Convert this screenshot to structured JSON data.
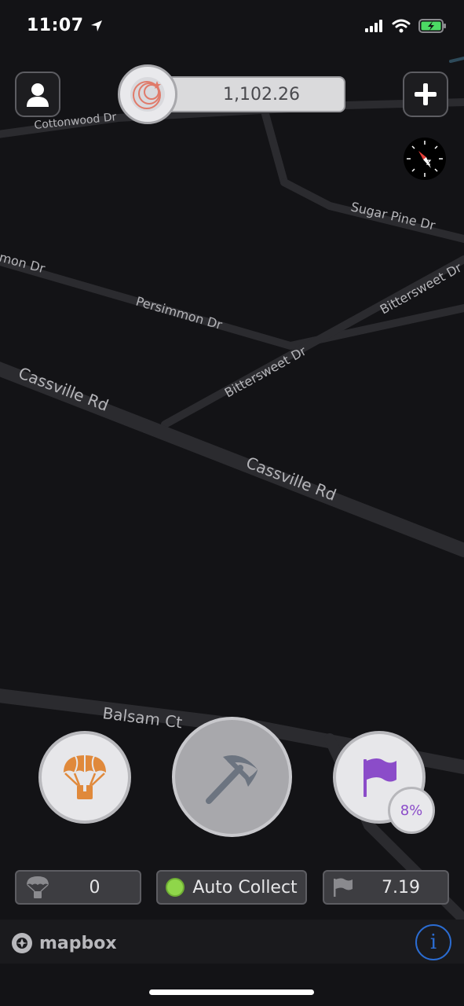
{
  "status_bar": {
    "time": "11:07",
    "icons": [
      "location-arrow-icon",
      "cellular-signal-icon",
      "wifi-icon",
      "battery-charging-icon"
    ]
  },
  "header": {
    "profile_icon": "person-icon",
    "balance": "1,102.26",
    "coin_icon": "coin-crescent-icon",
    "add_icon": "plus-icon",
    "compass_icon": "compass-icon"
  },
  "map": {
    "streets": {
      "cottonwood": "Cottonwood Dr",
      "sugar_pine": "Sugar Pine Dr",
      "persimmon_left": "mon Dr",
      "persimmon": "Persimmon Dr",
      "bittersweet_right": "Bittersweet Dr",
      "bittersweet": "Bittersweet Dr",
      "cassville_1": "Cassville Rd",
      "cassville_2": "Cassville Rd",
      "balsam": "Balsam Ct"
    }
  },
  "actions": {
    "airdrop_icon": "parachute-crate-icon",
    "mine_icon": "pickaxe-icon",
    "flag_icon": "flag-icon",
    "flag_percent": "8%"
  },
  "stats": {
    "airdrops_count": "0",
    "auto_collect_label": "Auto Collect",
    "flag_value": "7.19"
  },
  "footer": {
    "mapbox_label": "mapbox",
    "info_label": "i"
  },
  "colors": {
    "background": "#131316",
    "road": "#2a2a2e",
    "airdrop_orange": "#e0893b",
    "flag_purple": "#8b4cc9",
    "auto_collect_green": "#8fd64a",
    "info_blue": "#2b6cd1"
  }
}
